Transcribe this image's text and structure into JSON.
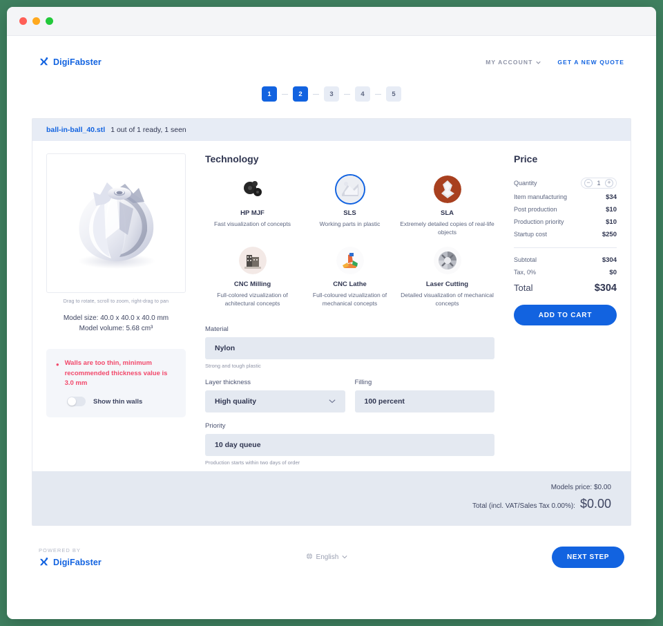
{
  "window": {
    "traffic_lights": [
      "close",
      "minimize",
      "maximize"
    ]
  },
  "header": {
    "brand": "DigiFabster",
    "my_account": "MY ACCOUNT",
    "new_quote": "GET A NEW QUOTE"
  },
  "steps": {
    "items": [
      {
        "label": "1",
        "state": "active"
      },
      {
        "label": "2",
        "state": "active"
      },
      {
        "label": "3",
        "state": "idle"
      },
      {
        "label": "4",
        "state": "idle"
      },
      {
        "label": "5",
        "state": "idle"
      }
    ]
  },
  "file_bar": {
    "name": "ball-in-ball_40.stl",
    "status": "1 out of 1 ready, 1 seen"
  },
  "viewer": {
    "hint": "Drag to rotate, scroll to zoom, right-drag to pan",
    "model_size": "Model size: 40.0 x 40.0 x 40.0 mm",
    "model_volume": "Model volume: 5.68 cm³"
  },
  "warning": {
    "text": "Walls are too thin, minimum recommended thickness value is 3.0 mm",
    "toggle_label": "Show thin walls",
    "toggle_on": false,
    "color": "#f2496b"
  },
  "technology": {
    "title": "Technology",
    "items": [
      {
        "name": "HP MJF",
        "desc": "Fast visualization of concepts",
        "selected": false
      },
      {
        "name": "SLS",
        "desc": "Working parts in plastic",
        "selected": true
      },
      {
        "name": "SLA",
        "desc": "Extremely detailed copies of real-life objects",
        "selected": false
      },
      {
        "name": "CNC Milling",
        "desc": "Full-colored vizualization of achitectural concepts",
        "selected": false
      },
      {
        "name": "CNC Lathe",
        "desc": "Full-coloured vizualization of mechanical concepts",
        "selected": false
      },
      {
        "name": "Laser Cutting",
        "desc": "Detailed visualization of mechanical concepts",
        "selected": false
      }
    ]
  },
  "form": {
    "material": {
      "label": "Material",
      "value": "Nylon",
      "hint": "Strong and tough plastic"
    },
    "layer_thickness": {
      "label": "Layer thickness",
      "value": "High quality"
    },
    "filling": {
      "label": "Filling",
      "value": "100 percent"
    },
    "priority": {
      "label": "Priority",
      "value": "10 day queue",
      "hint": "Production starts within two days of order"
    }
  },
  "price": {
    "title": "Price",
    "quantity_label": "Quantity",
    "quantity_value": "1",
    "minus": "−",
    "plus": "+",
    "lines": [
      {
        "label": "Item manufacturing",
        "value": "$34"
      },
      {
        "label": "Post production",
        "value": "$10"
      },
      {
        "label": "Production priority",
        "value": "$10"
      },
      {
        "label": "Startup cost",
        "value": "$250"
      }
    ],
    "subtotal": {
      "label": "Subtotal",
      "value": "$304"
    },
    "tax": {
      "label": "Tax, 0%",
      "value": "$0"
    },
    "total": {
      "label": "Total",
      "value": "$304"
    },
    "add_to_cart": "ADD TO CART",
    "accent": "#1263e0"
  },
  "summary": {
    "models_price": "Models price: $0.00",
    "total_label": "Total (incl. VAT/Sales Tax 0.00%):",
    "total_value": "$0.00"
  },
  "footer": {
    "powered_by": "POWERED BY",
    "brand": "DigiFabster",
    "language": "English",
    "next_step": "NEXT STEP"
  }
}
